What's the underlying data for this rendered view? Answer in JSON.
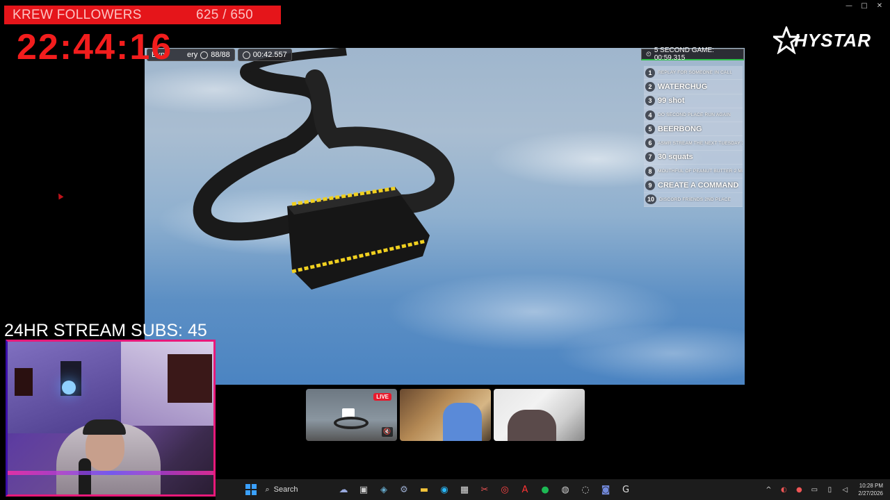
{
  "window": {
    "minimize": "—",
    "maximize": "□",
    "close": "✕"
  },
  "followers": {
    "label": "KREW FOLLOWERS",
    "count": "625 / 650"
  },
  "timer": "22:44:16",
  "hud": {
    "mode": "Exp",
    "mode_tail": "ery",
    "collected": "88/88",
    "time": "00:42.557"
  },
  "game_timer": {
    "label": "5 SECOND GAME: 00:59.315"
  },
  "leaderboard": [
    {
      "num": "1",
      "text": "REPLAY FOR SOMEONE IN CALL",
      "small": true
    },
    {
      "num": "2",
      "text": "WATERCHUG",
      "small": false
    },
    {
      "num": "3",
      "text": "99 shot",
      "small": false
    },
    {
      "num": "4",
      "text": "DO SECOND PLACE RUN AGAIN",
      "small": true
    },
    {
      "num": "5",
      "text": "BEERBONG",
      "small": false
    },
    {
      "num": "6",
      "text": "ASMR STREAM THE NEXT TUESDAY 30 MINUTES",
      "small": true
    },
    {
      "num": "7",
      "text": "30 squats",
      "small": false
    },
    {
      "num": "8",
      "text": "MOUTHFUL OF PEANUT BUTTER 2 MINUTES",
      "small": true
    },
    {
      "num": "9",
      "text": "CREATE A COMMAND",
      "small": false
    },
    {
      "num": "10",
      "text": "DISCORD FRIENDS 2ND PLACE",
      "small": true
    }
  ],
  "logo": {
    "text": "HYSTAR"
  },
  "subs": "24HR STREAM SUBS: 45",
  "thumbnails": {
    "live_badge": "LIVE",
    "mute_icon": "🔇"
  },
  "taskbar": {
    "search_label": "Search",
    "time": "10:28 PM",
    "date": "2/27/2026"
  },
  "colors": {
    "followers_bg": "#e5151a",
    "timer": "#f21d1d",
    "webcam_border": "#e8197a",
    "live": "#e8192c"
  }
}
